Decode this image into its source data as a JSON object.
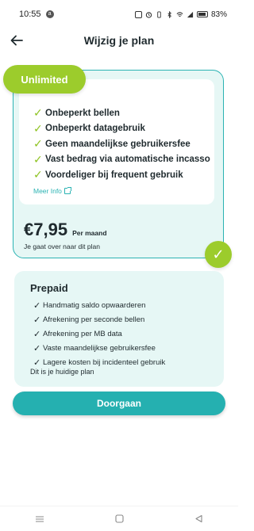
{
  "status_bar": {
    "time": "10:55",
    "battery": "83%",
    "icons": [
      "notification-icon",
      "nfc-icon",
      "alarm-icon",
      "vibrate-icon",
      "bluetooth-icon",
      "wifi-icon",
      "signal-icon",
      "battery-icon"
    ]
  },
  "header": {
    "title": "Wijzig je plan",
    "back_icon": "arrow-left-icon"
  },
  "selected_plan": {
    "name": "Unlimited",
    "features": [
      "Onbeperkt bellen",
      "Onbeperkt datagebruik",
      "Geen maandelijkse gebruikersfee",
      "Vast bedrag via automatische incasso",
      "Voordeliger bij frequent gebruik"
    ],
    "more_info": "Meer Info",
    "price": "€7,95",
    "price_unit": "Per maand",
    "note": "Je gaat over naar dit plan",
    "selected": true
  },
  "current_plan": {
    "name": "Prepaid",
    "features": [
      "Handmatig saldo opwaarderen",
      "Afrekening per seconde bellen",
      "Afrekening per MB data",
      "Vaste maandelijkse gebruikersfee",
      "Lagere kosten bij incidenteel gebruik"
    ],
    "note": "Dit is je huidige plan"
  },
  "actions": {
    "continue_label": "Doorgaan"
  },
  "nav": {
    "icons": [
      "recent-apps-icon",
      "home-icon",
      "back-icon"
    ]
  },
  "colors": {
    "accent_teal": "#25b0b0",
    "accent_green": "#9ccc2c",
    "card_bg": "#e6f7f5"
  }
}
